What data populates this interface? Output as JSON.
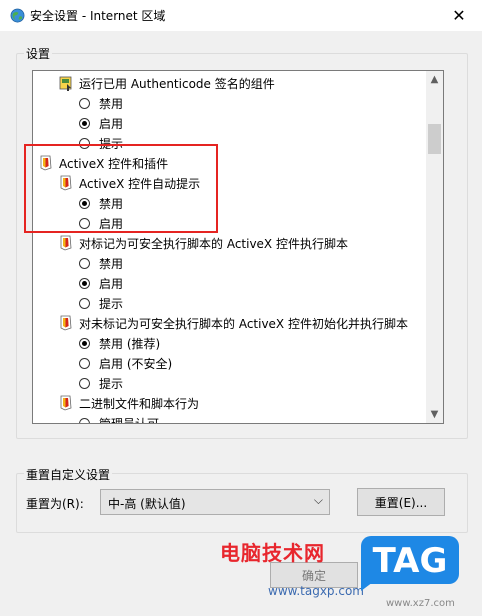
{
  "window": {
    "title": "安全设置 - Internet 区域",
    "close_symbol": "✕"
  },
  "settings_group": {
    "label": "设置",
    "rows": [
      {
        "kind": "heading",
        "icon": "authenticode-component-icon",
        "text": "运行已用 Authenticode 签名的组件",
        "checked": false
      },
      {
        "kind": "radio",
        "text": "禁用",
        "checked": false
      },
      {
        "kind": "radio",
        "text": "启用",
        "checked": true
      },
      {
        "kind": "radio",
        "text": "提示",
        "checked": false
      },
      {
        "kind": "category",
        "icon": "activex-policy-icon",
        "text": "ActiveX 控件和插件",
        "checked": false
      },
      {
        "kind": "heading",
        "icon": "activex-policy-icon",
        "text": "ActiveX 控件自动提示",
        "checked": false
      },
      {
        "kind": "radio",
        "text": "禁用",
        "checked": true
      },
      {
        "kind": "radio",
        "text": "启用",
        "checked": false
      },
      {
        "kind": "heading",
        "icon": "activex-policy-icon",
        "text": "对标记为可安全执行脚本的 ActiveX 控件执行脚本",
        "checked": false
      },
      {
        "kind": "radio",
        "text": "禁用",
        "checked": false
      },
      {
        "kind": "radio",
        "text": "启用",
        "checked": true
      },
      {
        "kind": "radio",
        "text": "提示",
        "checked": false
      },
      {
        "kind": "heading",
        "icon": "activex-policy-icon",
        "text": "对未标记为可安全执行脚本的 ActiveX 控件初始化并执行脚本",
        "checked": false
      },
      {
        "kind": "radio",
        "text": "禁用 (推荐)",
        "checked": true
      },
      {
        "kind": "radio",
        "text": "启用 (不安全)",
        "checked": false
      },
      {
        "kind": "radio",
        "text": "提示",
        "checked": false
      },
      {
        "kind": "heading",
        "icon": "activex-policy-icon",
        "text": "二进制文件和脚本行为",
        "checked": false
      },
      {
        "kind": "radio",
        "text": "管理员认可",
        "checked": false
      }
    ]
  },
  "reset_group": {
    "label": "重置自定义设置",
    "reset_to_label": "重置为(R):",
    "selected_level": "中-高 (默认值)",
    "reset_button": "重置(E)..."
  },
  "footer": {
    "ok_button": "确定"
  },
  "watermark": {
    "site_cn": "电脑技术网",
    "site_url": "www.tagxp.com",
    "logo_text": "TAG",
    "site_url2": "www.xz7.com"
  },
  "colors": {
    "highlight_border": "#e52421",
    "watermark_red": "#e8262d",
    "logo_blue": "#1e88e5"
  }
}
